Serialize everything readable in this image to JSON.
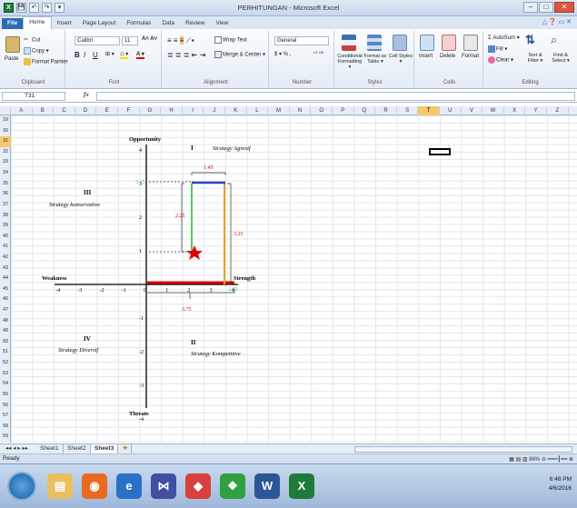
{
  "window": {
    "title": "PERHITUNGAN - Microsoft Excel",
    "qat": [
      "X",
      "💾",
      "↶",
      "↷",
      "▾"
    ],
    "controls": [
      "–",
      "□",
      "✕"
    ]
  },
  "tabs": [
    "File",
    "Home",
    "Insert",
    "Page Layout",
    "Formulas",
    "Data",
    "Review",
    "View"
  ],
  "ribbon": {
    "clipboard": {
      "paste": "Paste",
      "cut": "Cut",
      "copy": "Copy ▾",
      "format_painter": "Format Painter",
      "label": "Clipboard"
    },
    "font": {
      "name": "Calibri",
      "size": "11",
      "bold": "B",
      "italic": "I",
      "underline": "U",
      "label": "Font"
    },
    "alignment": {
      "wrap": "Wrap Text",
      "merge": "Merge & Center ▾",
      "label": "Alignment"
    },
    "number": {
      "format": "General",
      "currency": "$ ▾ % ,",
      "decimals": "⁺⁰ ⁰⁰",
      "label": "Number"
    },
    "styles": {
      "conditional": "Conditional Formatting ▾",
      "format_table": "Format as Table ▾",
      "cell_styles": "Cell Styles ▾",
      "label": "Styles"
    },
    "cells": {
      "insert": "Insert",
      "delete": "Delete",
      "format": "Format",
      "label": "Cells"
    },
    "editing": {
      "autosum": "Σ AutoSum ▾",
      "fill": "Fill ▾",
      "clear": "Clear ▾",
      "sort": "Sort & Filter ▾",
      "find": "Find & Select ▾",
      "label": "Editing"
    }
  },
  "formula_bar": {
    "name_box": "T31",
    "fx": "fx",
    "value": ""
  },
  "columns": [
    "A",
    "B",
    "C",
    "D",
    "E",
    "F",
    "G",
    "H",
    "I",
    "J",
    "K",
    "L",
    "M",
    "N",
    "O",
    "P",
    "Q",
    "R",
    "S",
    "T",
    "U",
    "V",
    "W",
    "X",
    "Y",
    "Z"
  ],
  "selected_column": "T",
  "rows": [
    "29",
    "30",
    "31",
    "32",
    "33",
    "34",
    "35",
    "36",
    "37",
    "38",
    "39",
    "40",
    "41",
    "42",
    "43",
    "44",
    "45",
    "46",
    "47",
    "48",
    "49",
    "50",
    "51",
    "52",
    "53",
    "54",
    "55",
    "56",
    "57",
    "58",
    "59"
  ],
  "selected_row": "31",
  "diagram": {
    "axis_labels": {
      "top": "Opportunity",
      "bottom": "Threats",
      "left": "Weakness",
      "right": "Strength"
    },
    "x_ticks": [
      "-4",
      "-3",
      "-2",
      "-1",
      "0",
      "1",
      "2",
      "3",
      "4"
    ],
    "y_ticks": [
      "4",
      "3",
      "2",
      "1",
      "0",
      "-1",
      "-2",
      "-3",
      "-4"
    ],
    "quadrants": {
      "q1": {
        "roman": "I",
        "name": "Strategy Agresif"
      },
      "q2": {
        "roman": "II",
        "name": "Strategy Kompetitive"
      },
      "q3": {
        "roman": "III",
        "name": "Strategy konservative"
      },
      "q4": {
        "roman": "IV",
        "name": "Strategy Diversif"
      }
    },
    "annotations": {
      "top_width": "1.45",
      "left_height": "2.25",
      "right_height": "3.25",
      "x_mark": "3.75",
      "y_mark": "3.25",
      "bottom_span": "3.75"
    },
    "point": {
      "x": 1.45,
      "y": 1.0
    },
    "colors": {
      "red": "#e00000",
      "green": "#5cc45c",
      "orange": "#f0a020",
      "blue": "#3040c0"
    }
  },
  "sheets": [
    "Sheet1",
    "Sheet2",
    "Sheet3"
  ],
  "active_sheet": "Sheet3",
  "status": {
    "ready": "Ready",
    "zoom": "86%"
  },
  "taskbar": {
    "time": "6:48 PM",
    "date": "4/6/2016"
  }
}
